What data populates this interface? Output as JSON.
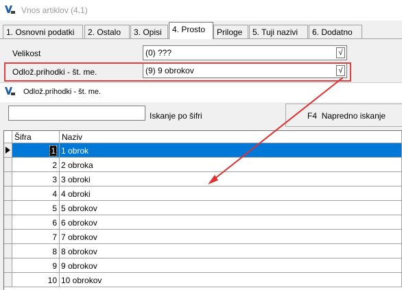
{
  "window": {
    "title": "Vnos artiklov  (4.1)"
  },
  "tabs": [
    {
      "label": "1. Osnovni podatki",
      "active": false
    },
    {
      "label": "2. Ostalo",
      "active": false
    },
    {
      "label": "3. Opisi",
      "active": false
    },
    {
      "label": "4. Prosto",
      "active": true
    },
    {
      "label": "Priloge",
      "active": false
    },
    {
      "label": "5. Tuji nazivi",
      "active": false
    },
    {
      "label": "6. Dodatno",
      "active": false
    }
  ],
  "fields": {
    "velikost": {
      "label": "Velikost",
      "value": "(0) ???",
      "button": "√"
    },
    "odloz": {
      "label": "Odlož.prihodki - št. me.",
      "value": "(9) 9 obrokov",
      "button": "√"
    }
  },
  "lookup": {
    "title": "Odlož.prihodki - št. me.",
    "search_value": "",
    "search_label": "Iskanje po šifri",
    "advanced_key": "F4",
    "advanced_label": "Napredno iskanje",
    "columns": [
      "Šifra",
      "Naziv"
    ],
    "rows": [
      {
        "sifra": "1",
        "naziv": "1 obrok",
        "selected": true
      },
      {
        "sifra": "2",
        "naziv": "2 obroka",
        "selected": false
      },
      {
        "sifra": "3",
        "naziv": "3 obroki",
        "selected": false
      },
      {
        "sifra": "4",
        "naziv": "4 obroki",
        "selected": false
      },
      {
        "sifra": "5",
        "naziv": "5 obrokov",
        "selected": false
      },
      {
        "sifra": "6",
        "naziv": "6 obrokov",
        "selected": false
      },
      {
        "sifra": "7",
        "naziv": "7 obrokov",
        "selected": false
      },
      {
        "sifra": "8",
        "naziv": "8 obrokov",
        "selected": false
      },
      {
        "sifra": "9",
        "naziv": "9 obrokov",
        "selected": false
      },
      {
        "sifra": "10",
        "naziv": "10 obrokov",
        "selected": false
      }
    ]
  },
  "colors": {
    "selection": "#0078d7",
    "highlight": "#e04040"
  },
  "icons": {
    "app": "app-logo-icon",
    "row_pointer": "row-pointer-icon",
    "checkmark": "checkmark-icon"
  }
}
